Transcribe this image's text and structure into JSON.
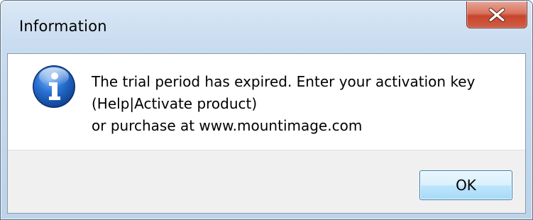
{
  "window": {
    "title": "Information",
    "close_icon": "close-icon"
  },
  "dialog": {
    "icon": "info-icon",
    "message_lines": [
      "The trial period has expired. Enter your activation key",
      "(Help|Activate product)",
      "or purchase at www.mountimage.com"
    ]
  },
  "buttons": {
    "ok_label": "OK"
  },
  "colors": {
    "titlebar_top": "#dbe8f6",
    "titlebar_bottom": "#bcd3ea",
    "close_button_red": "#c7452d",
    "info_icon_blue": "#1f63c5",
    "ok_button_border": "#3c7fb1",
    "button_bar_bg": "#f0f0f0"
  }
}
